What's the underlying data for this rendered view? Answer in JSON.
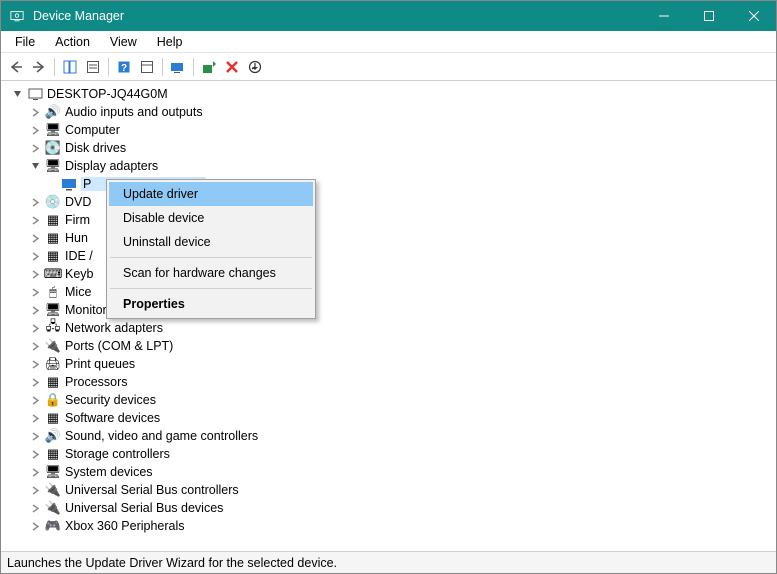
{
  "window": {
    "title": "Device Manager"
  },
  "menubar": {
    "file": "File",
    "action": "Action",
    "view": "View",
    "help": "Help"
  },
  "tree": {
    "root": "DESKTOP-JQ44G0M",
    "items": [
      {
        "label": "Audio inputs and outputs",
        "icon": "🔊"
      },
      {
        "label": "Computer",
        "icon": "🖥"
      },
      {
        "label": "Disk drives",
        "icon": "💽"
      },
      {
        "label": "Display adapters",
        "icon": "🖥",
        "expanded": true,
        "child": "P"
      },
      {
        "label": "DVD",
        "icon": "💿"
      },
      {
        "label": "Firm",
        "icon": "▦"
      },
      {
        "label": "Hun",
        "icon": "▦"
      },
      {
        "label": "IDE /",
        "icon": "▦"
      },
      {
        "label": "Keyb",
        "icon": "⌨"
      },
      {
        "label": "Mice",
        "icon": "🖱"
      },
      {
        "label": "Monitors",
        "icon": "🖥"
      },
      {
        "label": "Network adapters",
        "icon": "🖧"
      },
      {
        "label": "Ports (COM & LPT)",
        "icon": "🔌"
      },
      {
        "label": "Print queues",
        "icon": "🖨"
      },
      {
        "label": "Processors",
        "icon": "▦"
      },
      {
        "label": "Security devices",
        "icon": "🔒"
      },
      {
        "label": "Software devices",
        "icon": "▦"
      },
      {
        "label": "Sound, video and game controllers",
        "icon": "🔊"
      },
      {
        "label": "Storage controllers",
        "icon": "▦"
      },
      {
        "label": "System devices",
        "icon": "🖥"
      },
      {
        "label": "Universal Serial Bus controllers",
        "icon": "🔌"
      },
      {
        "label": "Universal Serial Bus devices",
        "icon": "🔌"
      },
      {
        "label": "Xbox 360 Peripherals",
        "icon": "🎮"
      }
    ]
  },
  "context_menu": {
    "update": "Update driver",
    "disable": "Disable device",
    "uninstall": "Uninstall device",
    "scan": "Scan for hardware changes",
    "props": "Properties"
  },
  "statusbar": {
    "text": "Launches the Update Driver Wizard for the selected device."
  }
}
